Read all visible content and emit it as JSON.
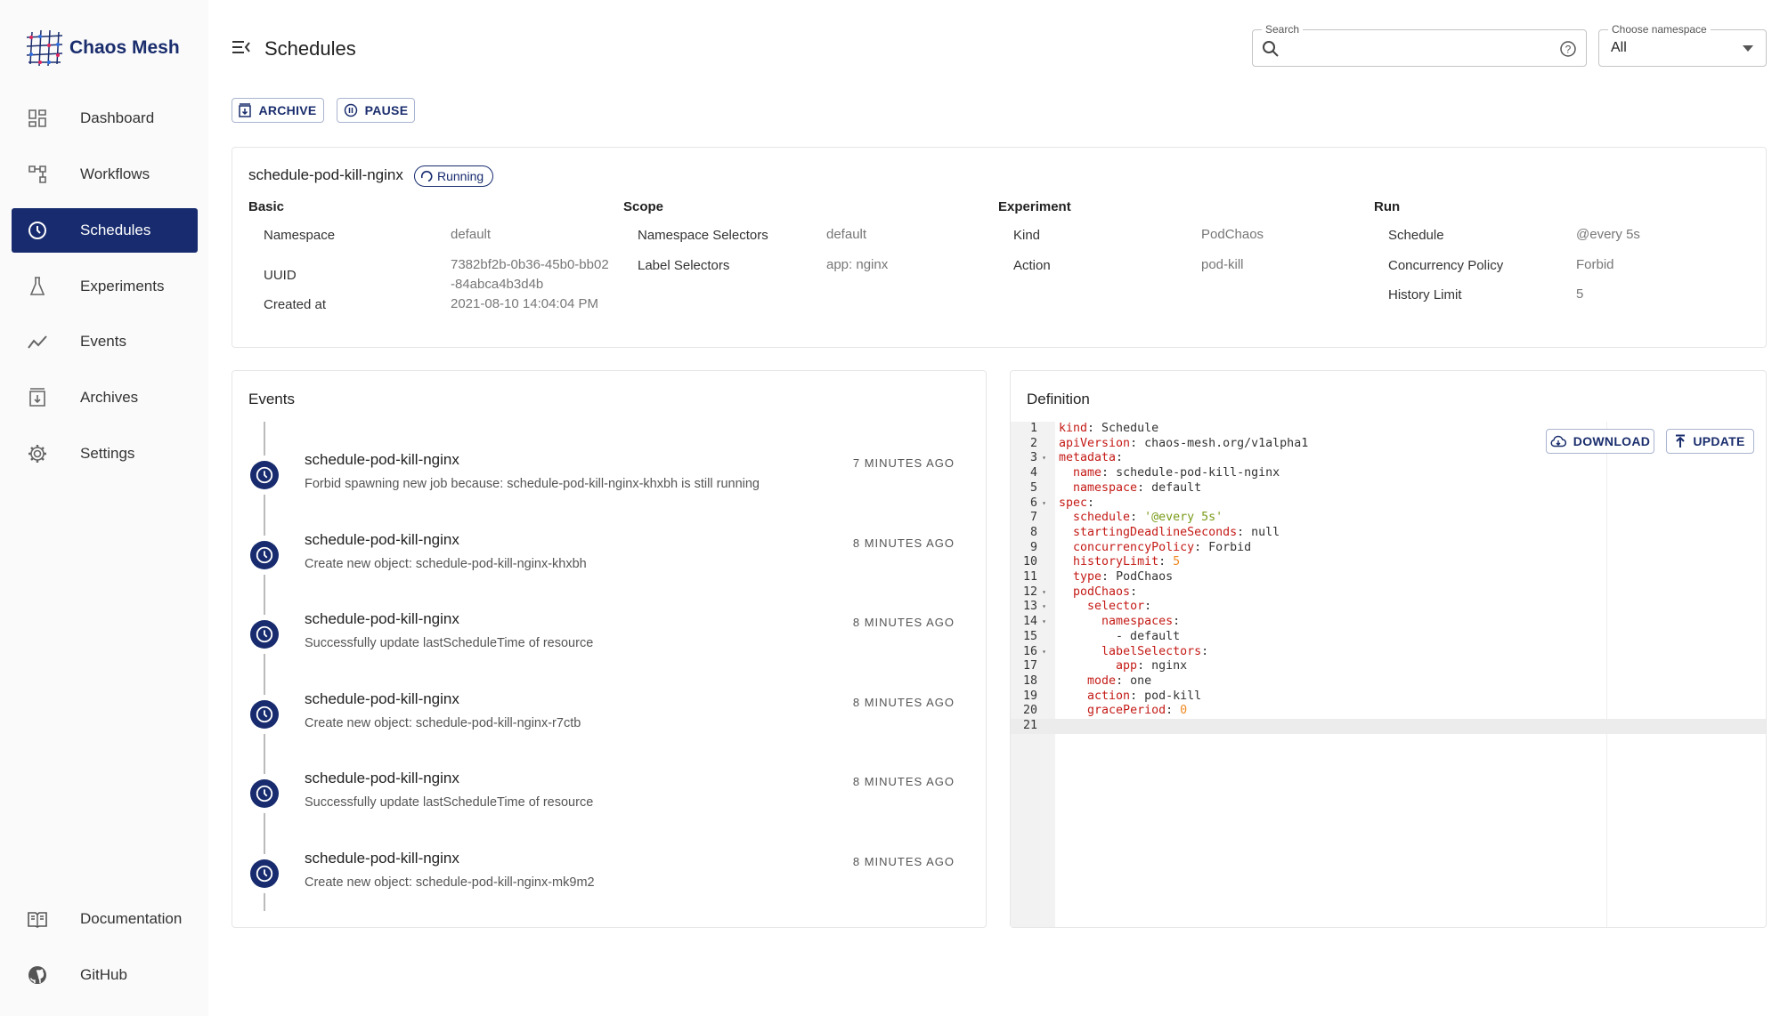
{
  "app": {
    "name": "Chaos Mesh"
  },
  "sidebar": {
    "items": [
      {
        "label": "Dashboard",
        "icon": "dashboard-icon"
      },
      {
        "label": "Workflows",
        "icon": "workflow-icon"
      },
      {
        "label": "Schedules",
        "icon": "clock-icon",
        "selected": true
      },
      {
        "label": "Experiments",
        "icon": "flask-icon"
      },
      {
        "label": "Events",
        "icon": "chart-line-icon"
      },
      {
        "label": "Archives",
        "icon": "archive-icon"
      },
      {
        "label": "Settings",
        "icon": "gear-icon"
      }
    ],
    "bottom": [
      {
        "label": "Documentation",
        "icon": "book-icon"
      },
      {
        "label": "GitHub",
        "icon": "github-icon"
      }
    ]
  },
  "header": {
    "title": "Schedules",
    "search_label": "Search",
    "search_value": "",
    "namespace_label": "Choose namespace",
    "namespace_value": "All"
  },
  "toolbar": {
    "archive": "ARCHIVE",
    "pause": "PAUSE"
  },
  "schedule": {
    "name": "schedule-pod-kill-nginx",
    "status": "Running",
    "basic": {
      "heading": "Basic",
      "rows": [
        [
          "Namespace",
          "default"
        ],
        [
          "UUID",
          "7382bf2b-0b36-45b0-bb02-84abca4b3d4b"
        ],
        [
          "Created at",
          "2021-08-10 14:04:04 PM"
        ]
      ]
    },
    "scope": {
      "heading": "Scope",
      "rows": [
        [
          "Namespace Selectors",
          "default"
        ],
        [
          "Label Selectors",
          "app: nginx"
        ]
      ]
    },
    "experiment": {
      "heading": "Experiment",
      "rows": [
        [
          "Kind",
          "PodChaos"
        ],
        [
          "Action",
          "pod-kill"
        ]
      ]
    },
    "run": {
      "heading": "Run",
      "rows": [
        [
          "Schedule",
          "@every 5s"
        ],
        [
          "Concurrency Policy",
          "Forbid"
        ],
        [
          "History Limit",
          "5"
        ]
      ]
    }
  },
  "events": {
    "title": "Events",
    "items": [
      {
        "name": "schedule-pod-kill-nginx",
        "desc": "Forbid spawning new job because: schedule-pod-kill-nginx-khxbh is still running",
        "time": "7 MINUTES AGO"
      },
      {
        "name": "schedule-pod-kill-nginx",
        "desc": "Create new object: schedule-pod-kill-nginx-khxbh",
        "time": "8 MINUTES AGO"
      },
      {
        "name": "schedule-pod-kill-nginx",
        "desc": "Successfully update lastScheduleTime of resource",
        "time": "8 MINUTES AGO"
      },
      {
        "name": "schedule-pod-kill-nginx",
        "desc": "Create new object: schedule-pod-kill-nginx-r7ctb",
        "time": "8 MINUTES AGO"
      },
      {
        "name": "schedule-pod-kill-nginx",
        "desc": "Successfully update lastScheduleTime of resource",
        "time": "8 MINUTES AGO"
      },
      {
        "name": "schedule-pod-kill-nginx",
        "desc": "Create new object: schedule-pod-kill-nginx-mk9m2",
        "time": "8 MINUTES AGO"
      }
    ]
  },
  "definition": {
    "title": "Definition",
    "download": "DOWNLOAD",
    "update": "UPDATE",
    "lines": [
      {
        "i": 0,
        "k": "kind",
        "v": "Schedule",
        "t": "p"
      },
      {
        "i": 0,
        "k": "apiVersion",
        "v": "chaos-mesh.org/v1alpha1",
        "t": "p"
      },
      {
        "i": 0,
        "k": "metadata",
        "v": "",
        "t": "p",
        "fold": true
      },
      {
        "i": 1,
        "k": "name",
        "v": "schedule-pod-kill-nginx",
        "t": "p"
      },
      {
        "i": 1,
        "k": "namespace",
        "v": "default",
        "t": "p"
      },
      {
        "i": 0,
        "k": "spec",
        "v": "",
        "t": "p",
        "fold": true
      },
      {
        "i": 1,
        "k": "schedule",
        "v": "'@every 5s'",
        "t": "s"
      },
      {
        "i": 1,
        "k": "startingDeadlineSeconds",
        "v": "null",
        "t": "p"
      },
      {
        "i": 1,
        "k": "concurrencyPolicy",
        "v": "Forbid",
        "t": "p"
      },
      {
        "i": 1,
        "k": "historyLimit",
        "v": "5",
        "t": "n"
      },
      {
        "i": 1,
        "k": "type",
        "v": "PodChaos",
        "t": "p"
      },
      {
        "i": 1,
        "k": "podChaos",
        "v": "",
        "t": "p",
        "fold": true
      },
      {
        "i": 2,
        "k": "selector",
        "v": "",
        "t": "p",
        "fold": true
      },
      {
        "i": 3,
        "k": "namespaces",
        "v": "",
        "t": "p",
        "fold": true
      },
      {
        "i": 4,
        "k": "",
        "v": "- default",
        "t": "p"
      },
      {
        "i": 3,
        "k": "labelSelectors",
        "v": "",
        "t": "p",
        "fold": true
      },
      {
        "i": 4,
        "k": "app",
        "v": "nginx",
        "t": "p"
      },
      {
        "i": 2,
        "k": "mode",
        "v": "one",
        "t": "p"
      },
      {
        "i": 2,
        "k": "action",
        "v": "pod-kill",
        "t": "p"
      },
      {
        "i": 2,
        "k": "gracePeriod",
        "v": "0",
        "t": "n"
      },
      {
        "i": 0,
        "k": "",
        "v": "",
        "t": "p"
      }
    ]
  },
  "colors": {
    "primary": "#172b6e",
    "sidebar_bg": "#fafafa",
    "yaml_key": "#c41a16",
    "yaml_string": "#7a9c1a",
    "yaml_number": "#f08a24"
  }
}
